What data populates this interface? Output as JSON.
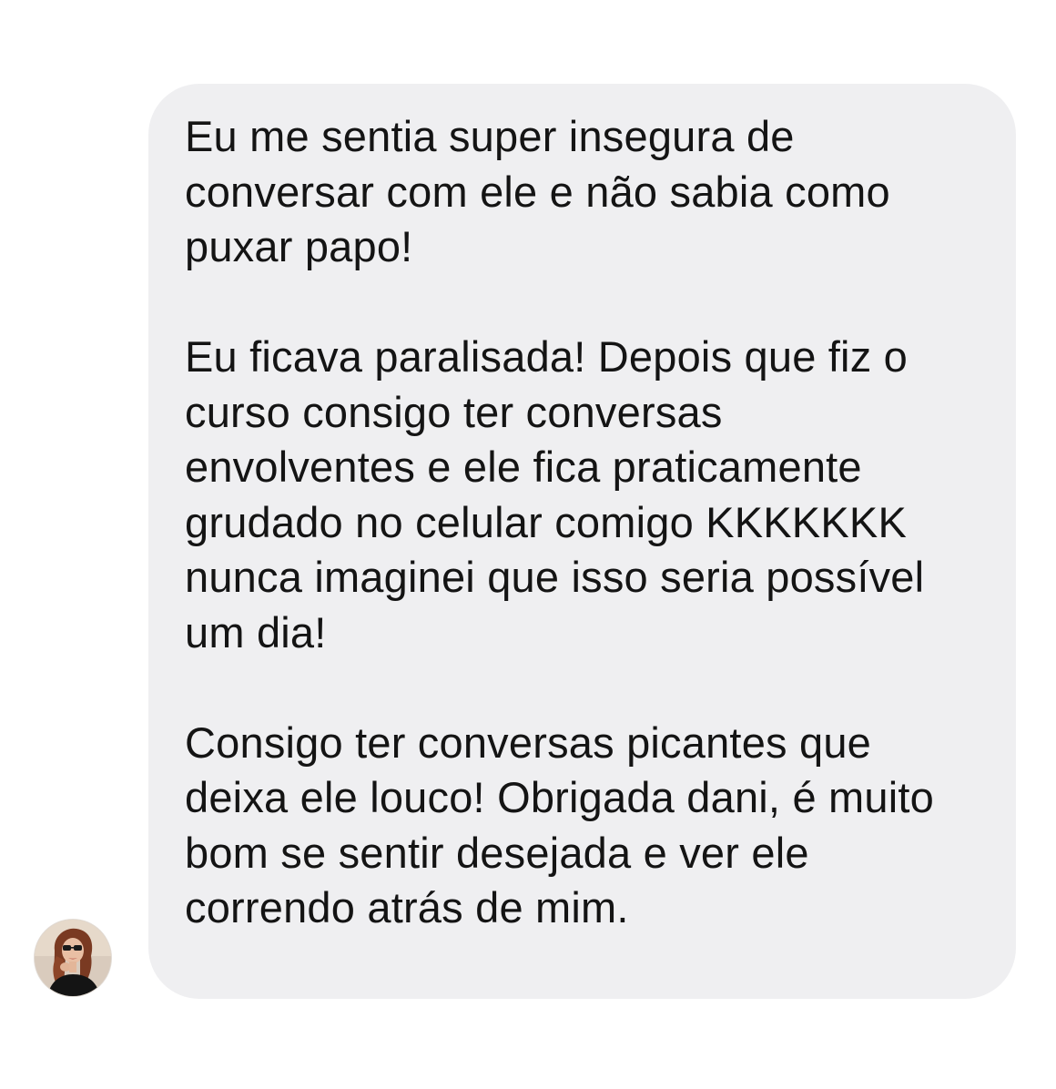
{
  "message": {
    "paragraphs": [
      {
        "lines": [
          "Eu me sentia super insegura de",
          "conversar com ele e não sabia como",
          "puxar papo!"
        ]
      },
      {
        "lines": [
          "Eu ficava paralisada! Depois que fiz o",
          "curso consigo ter conversas",
          "envolventes e ele fica praticamente",
          "grudado no celular comigo KKKKKKK",
          "nunca imaginei que isso seria possível",
          "um dia!"
        ]
      },
      {
        "lines": [
          "Consigo ter conversas picantes que",
          "deixa ele louco! Obrigada dani, é muito",
          "bom se sentir desejada e ver ele",
          "correndo atrás de mim."
        ]
      }
    ]
  },
  "colors": {
    "bubble_background": "#efeff1",
    "text": "#141414",
    "page_background": "#ffffff"
  },
  "avatar": {
    "icon": "user-photo-avatar"
  }
}
